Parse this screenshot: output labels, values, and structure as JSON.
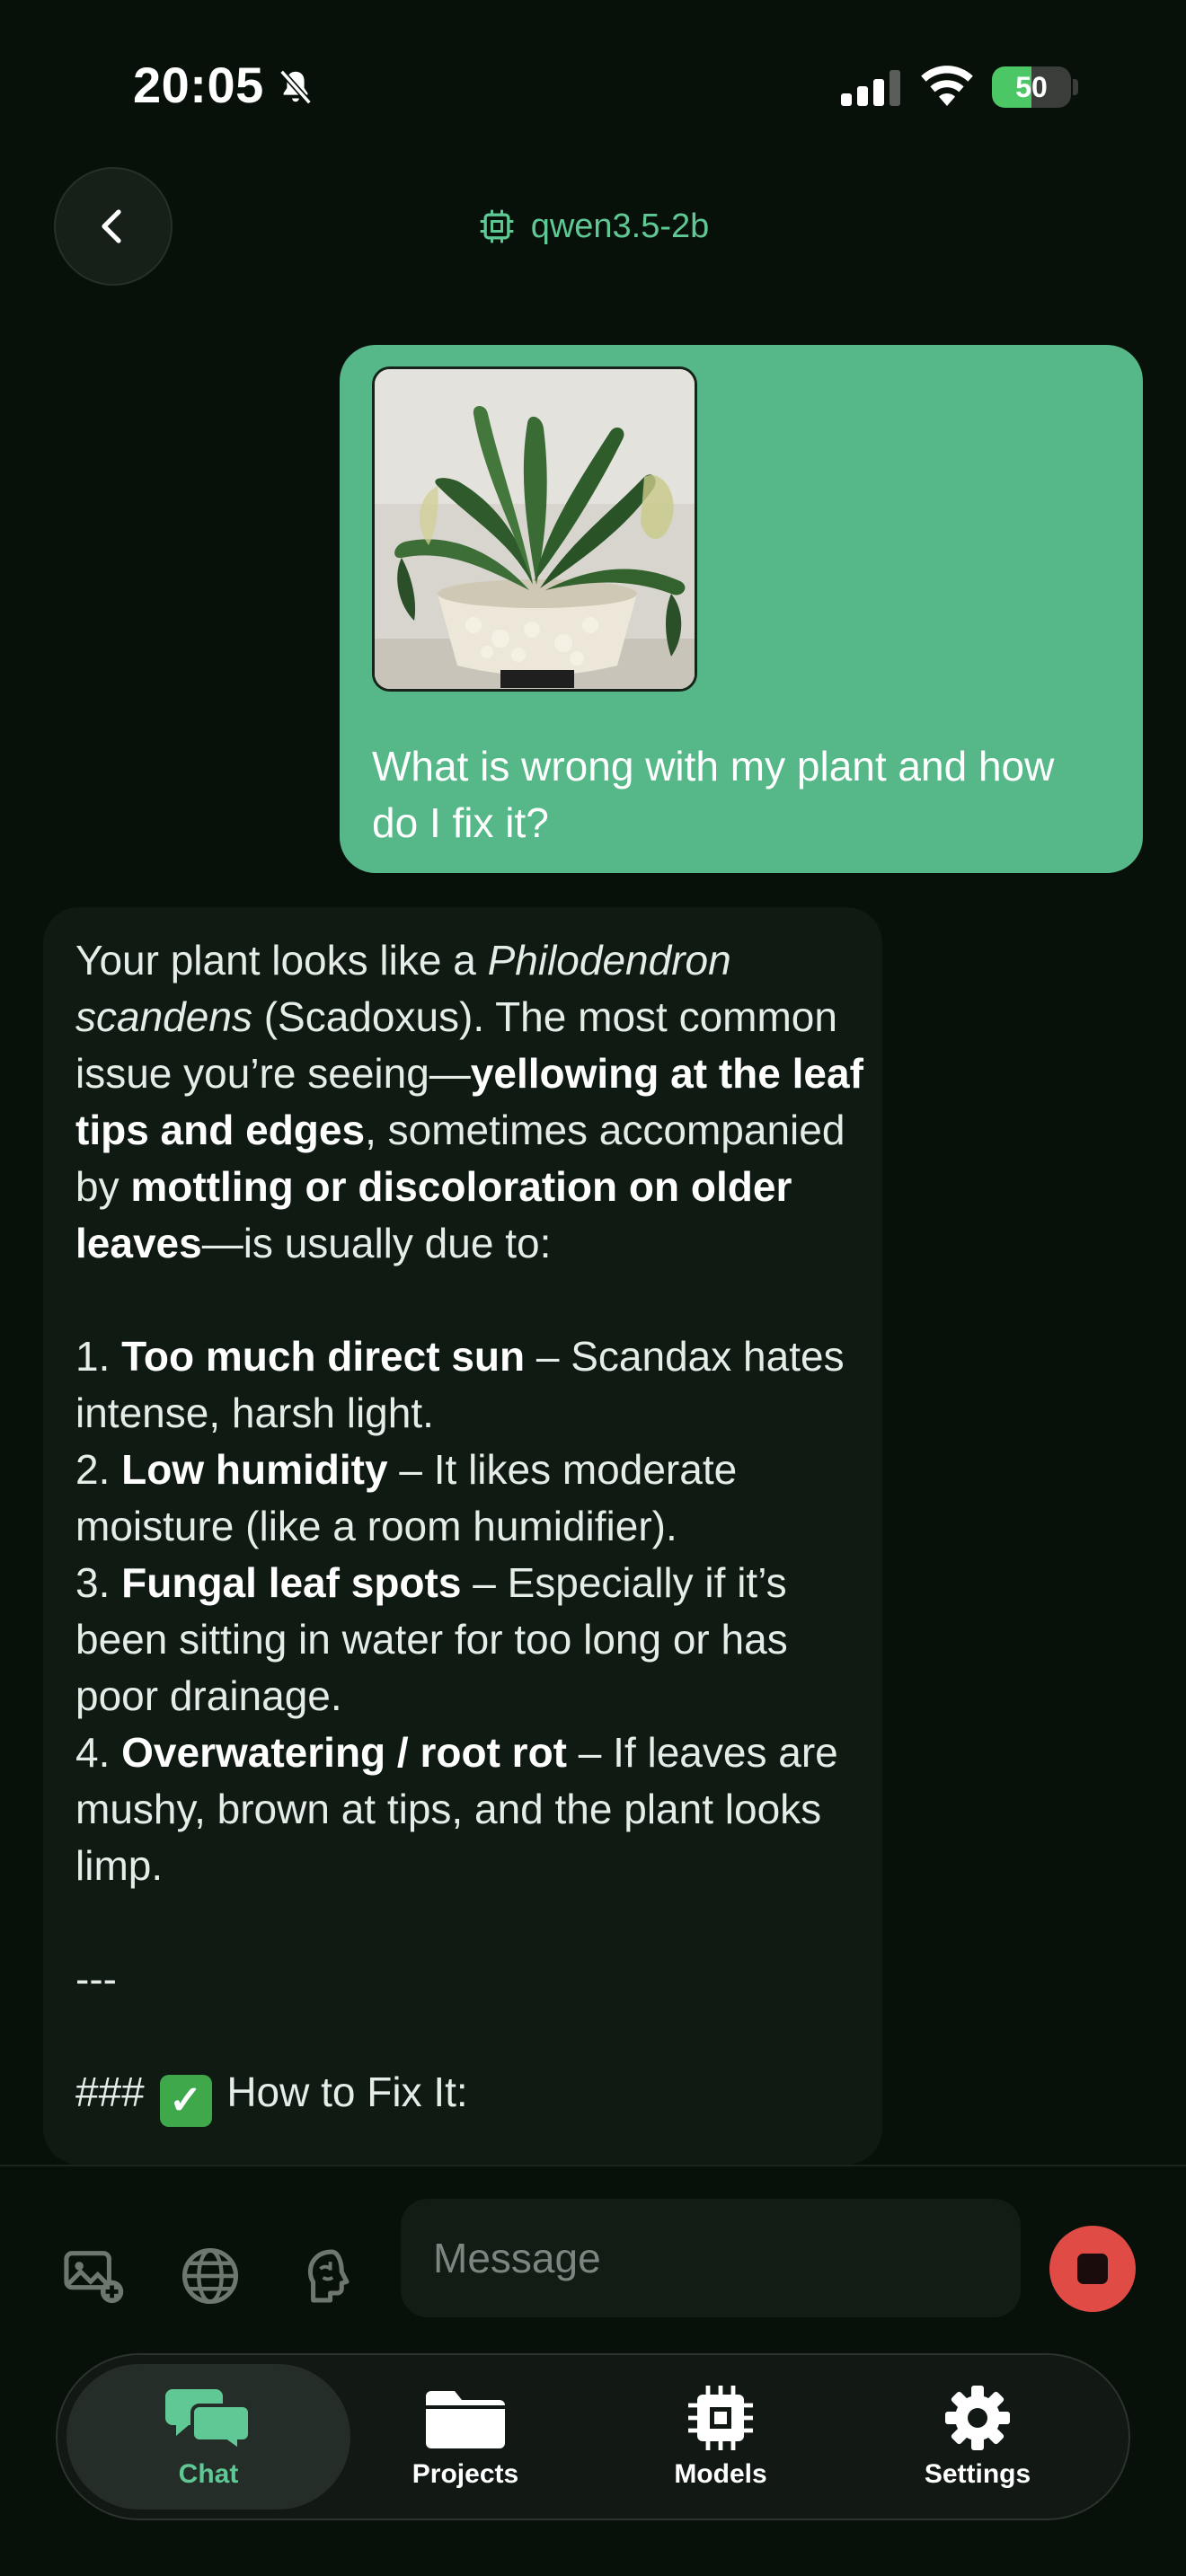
{
  "status_bar": {
    "time": "20:05",
    "battery_level": "50",
    "battery_fraction": 0.5
  },
  "header": {
    "model_name": "qwen3.5-2b"
  },
  "colors": {
    "accent": "#56b888",
    "accent_text": "#5fc894",
    "background": "#071009",
    "stop": "#e04b46"
  },
  "user_message": {
    "text": "What is wrong with my plant and how do I fix it?"
  },
  "assistant_message": {
    "intro": {
      "t1": "Your plant looks like a ",
      "t2": "Philodendron scandens",
      "t3": " (Scadoxus). The most common issue you’re seeing—",
      "t4": "yellowing at the leaf tips and edges",
      "t5": ", sometimes accompanied by ",
      "t6": "mottling or discoloration on older leaves",
      "t7": "—is usually due to:"
    },
    "causes": [
      {
        "num": "1. ",
        "title": "Too much direct sun",
        "desc": " – Scandax hates intense, harsh light."
      },
      {
        "num": "2. ",
        "title": "Low humidity",
        "desc": " – It likes moderate moisture (like a room humidifier)."
      },
      {
        "num": "3. ",
        "title": "Fungal leaf spots",
        "desc": " – Especially if it’s been sitting in water for too long or has poor drainage."
      },
      {
        "num": "4. ",
        "title": "Overwatering / root rot",
        "desc": " – If leaves are mushy, brown at tips, and the plant looks limp."
      }
    ],
    "divider": "---",
    "heading_prefix": "###",
    "heading_emoji": "✓",
    "heading_text": "How to Fix It:"
  },
  "composer": {
    "placeholder": "Message",
    "icons": [
      "image-add-icon",
      "globe-icon",
      "brain-icon",
      "stop-icon"
    ]
  },
  "tabs": [
    {
      "label": "Chat",
      "icon": "chat-icon",
      "active": true
    },
    {
      "label": "Projects",
      "icon": "folder-icon",
      "active": false
    },
    {
      "label": "Models",
      "icon": "chip-icon",
      "active": false
    },
    {
      "label": "Settings",
      "icon": "gear-icon",
      "active": false
    }
  ]
}
